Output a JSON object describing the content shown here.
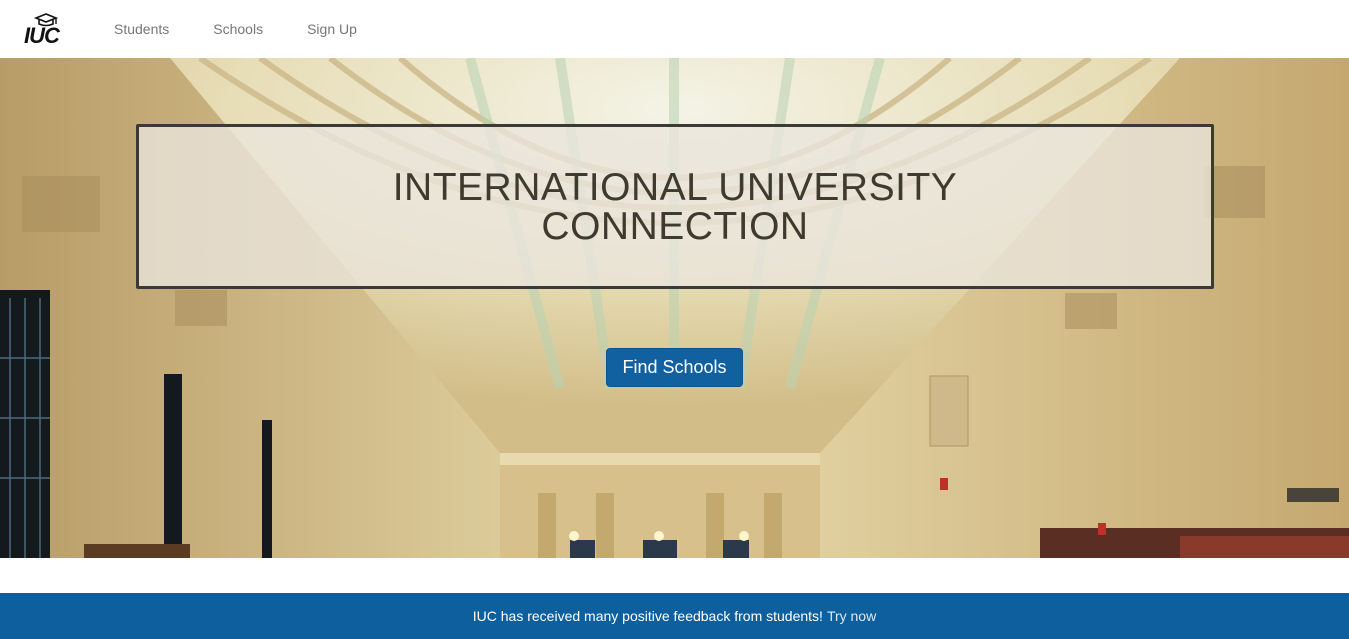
{
  "brand": {
    "logo_text": "IUC",
    "logo_icon": "graduation-cap-icon"
  },
  "nav": {
    "items": [
      {
        "label": "Students"
      },
      {
        "label": "Schools"
      },
      {
        "label": "Sign Up"
      }
    ]
  },
  "hero": {
    "title_line1": "INTERNATIONAL UNIVERSITY",
    "title_line2": "CONNECTION",
    "cta_label": "Find Schools"
  },
  "banner": {
    "text": "IUC has received many positive feedback from students!",
    "link_label": "Try now"
  },
  "colors": {
    "primary": "#1160a0",
    "banner": "#0e5f9e",
    "nav_text": "#777777"
  }
}
